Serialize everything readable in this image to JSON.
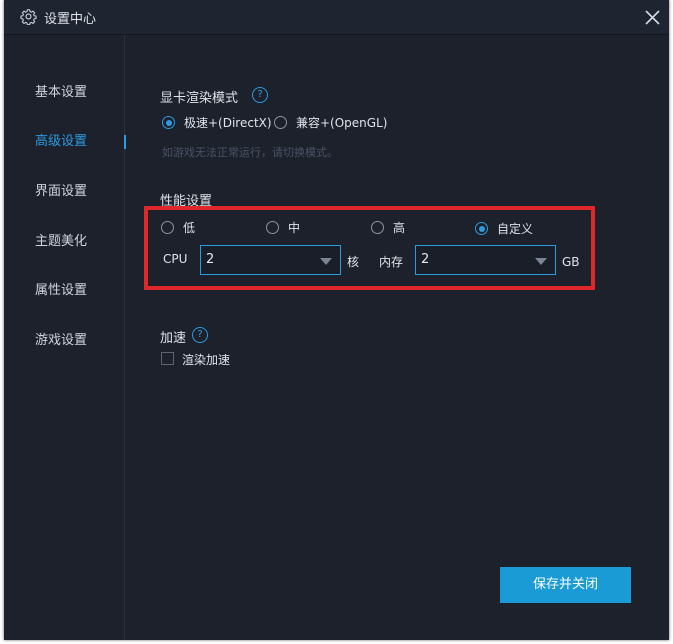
{
  "window": {
    "title": "设置中心"
  },
  "sidebar": {
    "items": [
      {
        "label": "基本设置",
        "active": false
      },
      {
        "label": "高级设置",
        "active": true
      },
      {
        "label": "界面设置",
        "active": false
      },
      {
        "label": "主题美化",
        "active": false
      },
      {
        "label": "属性设置",
        "active": false
      },
      {
        "label": "游戏设置",
        "active": false
      }
    ]
  },
  "render_mode": {
    "title": "显卡渲染模式",
    "help": "?",
    "options": [
      {
        "label": "极速+(DirectX)",
        "checked": true
      },
      {
        "label": "兼容+(OpenGL)",
        "checked": false
      }
    ],
    "hint": "如游戏无法正常运行，请切换模式。"
  },
  "performance": {
    "title": "性能设置",
    "options": [
      {
        "label": "低",
        "checked": false
      },
      {
        "label": "中",
        "checked": false
      },
      {
        "label": "高",
        "checked": false
      },
      {
        "label": "自定义",
        "checked": true
      }
    ],
    "cpu_label": "CPU",
    "cpu_value": "2",
    "cpu_unit": "核",
    "memory_label": "内存",
    "memory_value": "2",
    "memory_unit": "GB"
  },
  "acceleration": {
    "title": "加速",
    "help": "?",
    "render_accel_label": "渲染加速",
    "render_accel_checked": false
  },
  "footer": {
    "save_close_label": "保存并关闭"
  },
  "colors": {
    "accent": "#2d9be0",
    "highlight_box": "#e0282b",
    "background": "#1c212c"
  }
}
